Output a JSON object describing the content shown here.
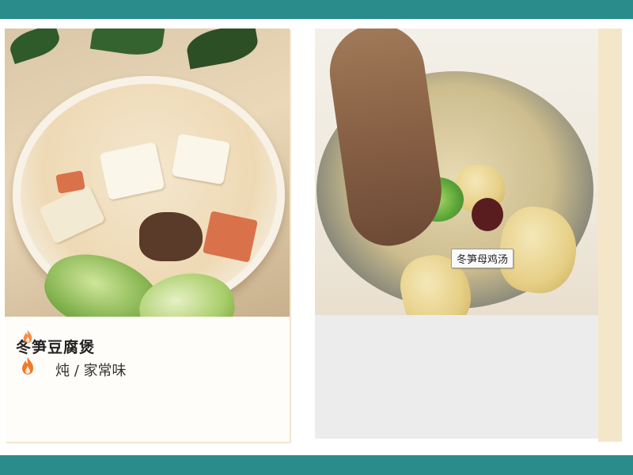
{
  "cards": [
    {
      "title": "冬笋豆腐煲"
    },
    {
      "photo_tag": "冬笋母鸡汤",
      "info": "炖 / 家常味",
      "icons": [
        "flame-icon",
        "flame-icon"
      ]
    }
  ],
  "colors": {
    "top_bar": "#2b8c8c",
    "bottom_bar": "#2b8c8c",
    "flame": "#f07a2a"
  }
}
